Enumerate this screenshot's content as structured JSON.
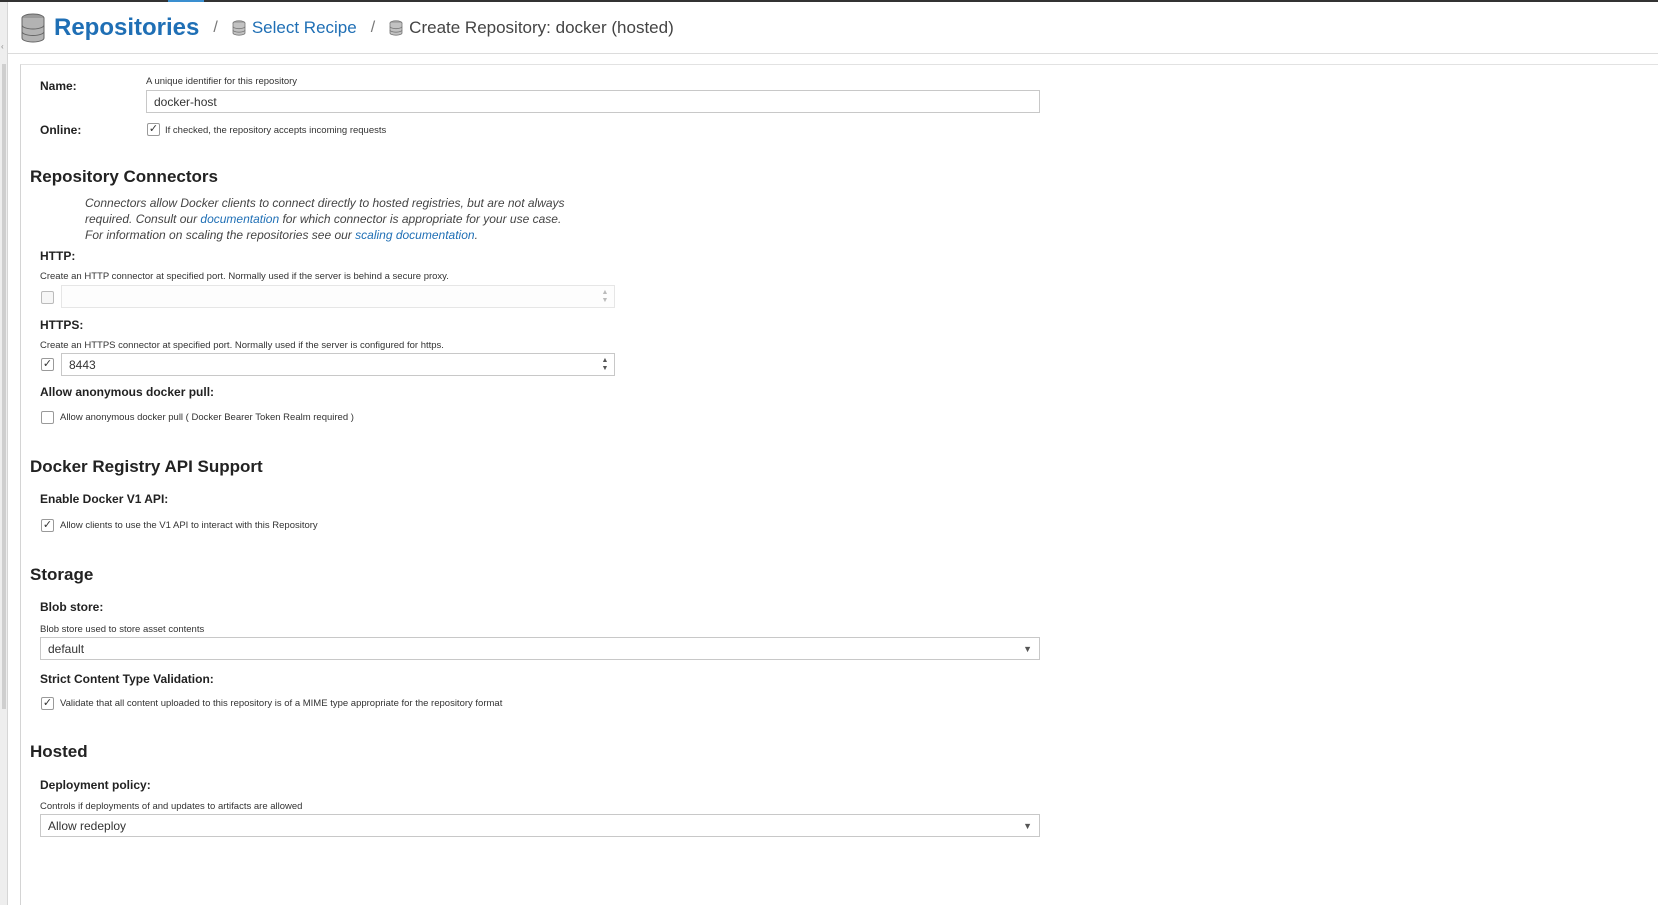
{
  "breadcrumb": {
    "title": "Repositories",
    "select_recipe": "Select Recipe",
    "current": "Create Repository: docker (hosted)",
    "separator": "/",
    "icons": {
      "title": "database-icon",
      "recipe": "database-icon",
      "current": "database-icon"
    }
  },
  "name_field": {
    "label": "Name:",
    "help": "A unique identifier for this repository",
    "value": "docker-host"
  },
  "online_field": {
    "label": "Online:",
    "checked": true,
    "help": "If checked, the repository accepts incoming requests"
  },
  "connectors": {
    "title": "Repository Connectors",
    "note_part1": "Connectors allow Docker clients to connect directly to hosted registries, but are not always required. Consult our ",
    "note_link1": "documentation",
    "note_part2": " for which connector is appropriate for your use case. For information on scaling the repositories see our ",
    "note_link2": "scaling documentation",
    "note_part3": ".",
    "http": {
      "label": "HTTP:",
      "help": "Create an HTTP connector at specified port. Normally used if the server is behind a secure proxy.",
      "checked": false,
      "value": ""
    },
    "https": {
      "label": "HTTPS:",
      "help": "Create an HTTPS connector at specified port. Normally used if the server is configured for https.",
      "checked": true,
      "value": "8443"
    },
    "anonymous": {
      "label": "Allow anonymous docker pull:",
      "checked": false,
      "help": "Allow anonymous docker pull ( Docker Bearer Token Realm required )"
    }
  },
  "docker_api": {
    "title": "Docker Registry API Support",
    "v1": {
      "label": "Enable Docker V1 API:",
      "checked": true,
      "help": "Allow clients to use the V1 API to interact with this Repository"
    }
  },
  "storage": {
    "title": "Storage",
    "blob_store": {
      "label": "Blob store:",
      "help": "Blob store used to store asset contents",
      "value": "default"
    },
    "strict": {
      "label": "Strict Content Type Validation:",
      "checked": true,
      "help": "Validate that all content uploaded to this repository is of a MIME type appropriate for the repository format"
    }
  },
  "hosted": {
    "title": "Hosted",
    "deployment": {
      "label": "Deployment policy:",
      "help": "Controls if deployments of and updates to artifacts are allowed",
      "value": "Allow redeploy"
    }
  },
  "glyphs": {
    "check": "✓",
    "caret": "▼",
    "spin_up": "▲",
    "spin_down": "▼"
  },
  "colors": {
    "link": "#1f6fb5",
    "text": "#222222",
    "border": "#c8c8c8"
  }
}
